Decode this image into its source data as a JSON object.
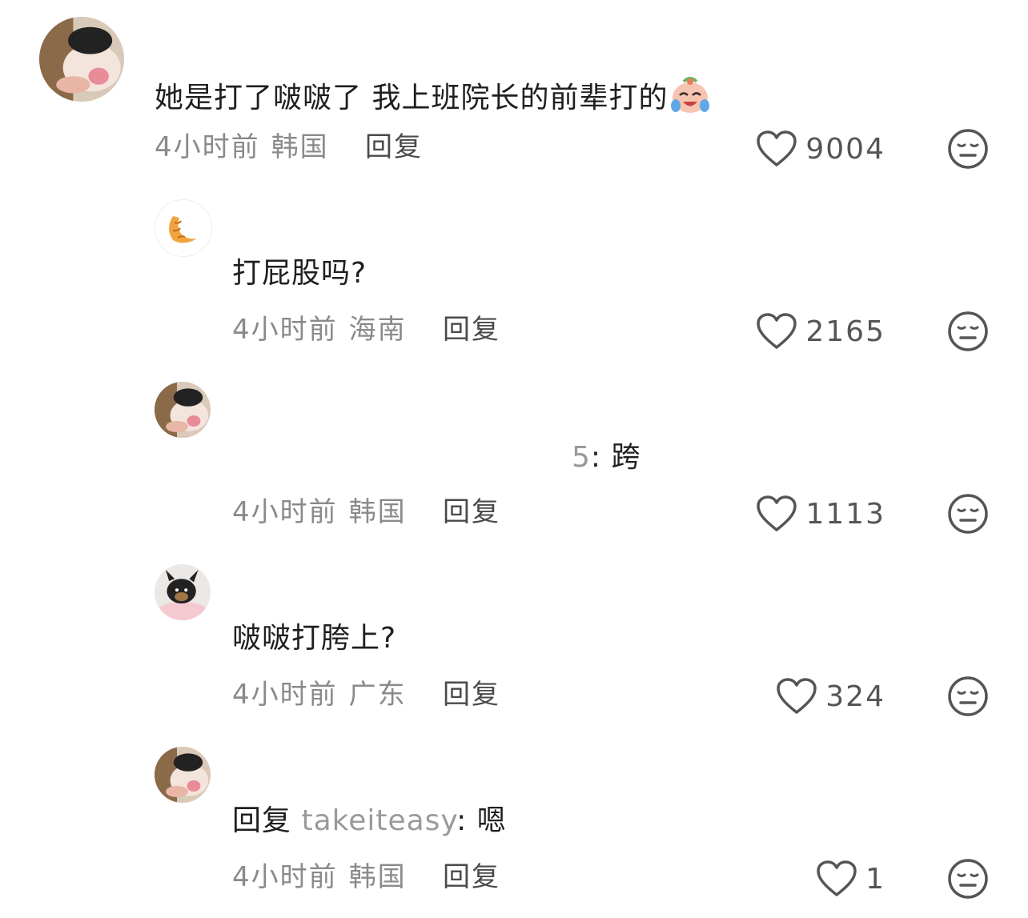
{
  "comments": [
    {
      "text": "她是打了啵啵了 我上班院长的前辈打的",
      "emoji": "crying-laughing-emoji",
      "time": "4小时前",
      "location": "韩国",
      "reply_label": "回复",
      "likes": "9004",
      "avatar": "pig-photo-avatar"
    },
    {
      "text": "打屁股吗?",
      "time": "4小时前",
      "location": "海南",
      "reply_label": "回复",
      "likes": "2165",
      "avatar": "croissant-avatar"
    },
    {
      "text_fragment": "5",
      "text": ": 跨",
      "time": "4小时前",
      "location": "韩国",
      "reply_label": "回复",
      "likes": "1113",
      "avatar": "pig-photo-avatar"
    },
    {
      "text": "啵啵打胯上?",
      "time": "4小时前",
      "location": "广东",
      "reply_label": "回复",
      "likes": "324",
      "avatar": "dog-photo-avatar"
    },
    {
      "reply_prefix": "回复",
      "mention": "takeiteasy",
      "text": ": 嗯",
      "time": "4小时前",
      "location": "韩国",
      "reply_label": "回复",
      "likes": "1",
      "avatar": "pig-photo-avatar"
    }
  ],
  "icons": {
    "like": "heart-outline-icon",
    "dislike": "neutral-face-icon"
  },
  "colors": {
    "meta_text": "#8a8a8a",
    "reply_text": "#4a4a4a",
    "mention": "#9a9a9a",
    "icon_stroke": "#555555"
  }
}
